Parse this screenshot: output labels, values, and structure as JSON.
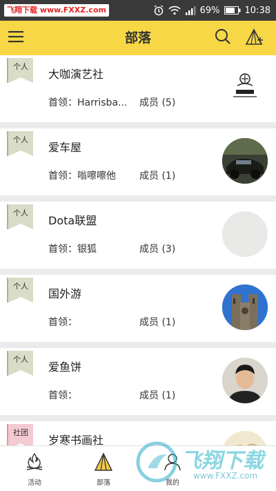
{
  "status_bar": {
    "watermark": "飞翔下载 www.FXXZ.com",
    "battery": "69%",
    "time": "10:38"
  },
  "header": {
    "title": "部落"
  },
  "tribes": [
    {
      "tag": "个人",
      "tag_type": "personal",
      "name": "大咖演艺社",
      "leader": "首领：Harrisba...",
      "members": "成员 (5)",
      "avatar": "logo-avatar"
    },
    {
      "tag": "个人",
      "tag_type": "personal",
      "name": "爱车屋",
      "leader": "首领：嗡嚓嚓他",
      "members": "成员 (1)",
      "avatar": "car-photo-avatar"
    },
    {
      "tag": "个人",
      "tag_type": "personal",
      "name": "Dota联盟",
      "leader": "首领：银狐",
      "members": "成员 (3)",
      "avatar": "blank-avatar"
    },
    {
      "tag": "个人",
      "tag_type": "personal",
      "name": "国外游",
      "leader": "首领：",
      "members": "成员 (1)",
      "avatar": "cathedral-photo-avatar"
    },
    {
      "tag": "个人",
      "tag_type": "personal",
      "name": "爱鱼饼",
      "leader": "首领：",
      "members": "成员 (1)",
      "avatar": "person-photo-avatar"
    },
    {
      "tag": "社团",
      "tag_type": "social",
      "name": "岁寒书画社",
      "leader": "",
      "members": "",
      "avatar": "painting-avatar"
    }
  ],
  "bottom_nav": [
    {
      "label": "活动",
      "icon": "campfire-icon"
    },
    {
      "label": "部落",
      "icon": "tent-icon"
    },
    {
      "label": "我的",
      "icon": "user-icon"
    }
  ],
  "site_watermark": {
    "title": "飞翔下载",
    "url": "www.FXXZ.com"
  },
  "colors": {
    "header": "#f7d745",
    "personal_tag": "#d9dcc6",
    "social_tag": "#f3c9d2"
  }
}
